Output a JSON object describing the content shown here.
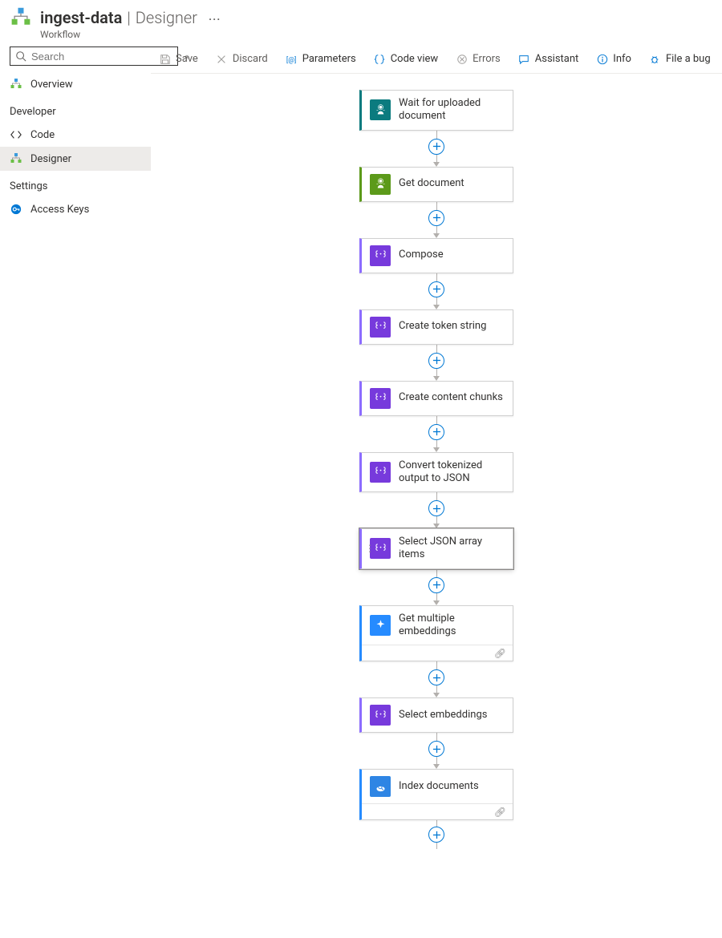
{
  "header": {
    "title": "ingest-data",
    "page": "Designer",
    "subtitle": "Workflow"
  },
  "search": {
    "placeholder": "Search"
  },
  "sidebar": {
    "items": [
      {
        "label": "Overview"
      }
    ],
    "groups": [
      {
        "title": "Developer",
        "items": [
          {
            "label": "Code"
          },
          {
            "label": "Designer"
          }
        ]
      },
      {
        "title": "Settings",
        "items": [
          {
            "label": "Access Keys"
          }
        ]
      }
    ]
  },
  "toolbar": {
    "save": "Save",
    "discard": "Discard",
    "parameters": "Parameters",
    "codeview": "Code view",
    "errors": "Errors",
    "assistant": "Assistant",
    "info": "Info",
    "filebug": "File a bug"
  },
  "workflow": {
    "nodes": [
      {
        "title": "Wait for uploaded document",
        "accent": "#0b7b7f",
        "iconBg": "#0b7b7f",
        "kind": "ai",
        "selected": false,
        "footer": false
      },
      {
        "title": "Get document",
        "accent": "#5c9a1a",
        "iconBg": "#5c9a1a",
        "kind": "ai",
        "selected": false,
        "footer": false
      },
      {
        "title": "Compose",
        "accent": "#8c6cff",
        "iconBg": "#773adc",
        "kind": "data",
        "selected": false,
        "footer": false
      },
      {
        "title": "Create token string",
        "accent": "#8c6cff",
        "iconBg": "#773adc",
        "kind": "data",
        "selected": false,
        "footer": false
      },
      {
        "title": "Create content chunks",
        "accent": "#8c6cff",
        "iconBg": "#773adc",
        "kind": "data",
        "selected": false,
        "footer": false
      },
      {
        "title": "Convert tokenized output to JSON",
        "accent": "#8c6cff",
        "iconBg": "#773adc",
        "kind": "data",
        "selected": false,
        "footer": false
      },
      {
        "title": "Select JSON array items",
        "accent": "#8c6cff",
        "iconBg": "#773adc",
        "kind": "data",
        "selected": true,
        "footer": false
      },
      {
        "title": "Get multiple embeddings",
        "accent": "#268bff",
        "iconBg": "#268bff",
        "kind": "sparkle",
        "selected": false,
        "footer": true
      },
      {
        "title": "Select embeddings",
        "accent": "#8c6cff",
        "iconBg": "#773adc",
        "kind": "data",
        "selected": false,
        "footer": false
      },
      {
        "title": "Index documents",
        "accent": "#268bff",
        "iconBg": "#2e85e4",
        "kind": "search",
        "selected": false,
        "footer": true
      }
    ]
  }
}
